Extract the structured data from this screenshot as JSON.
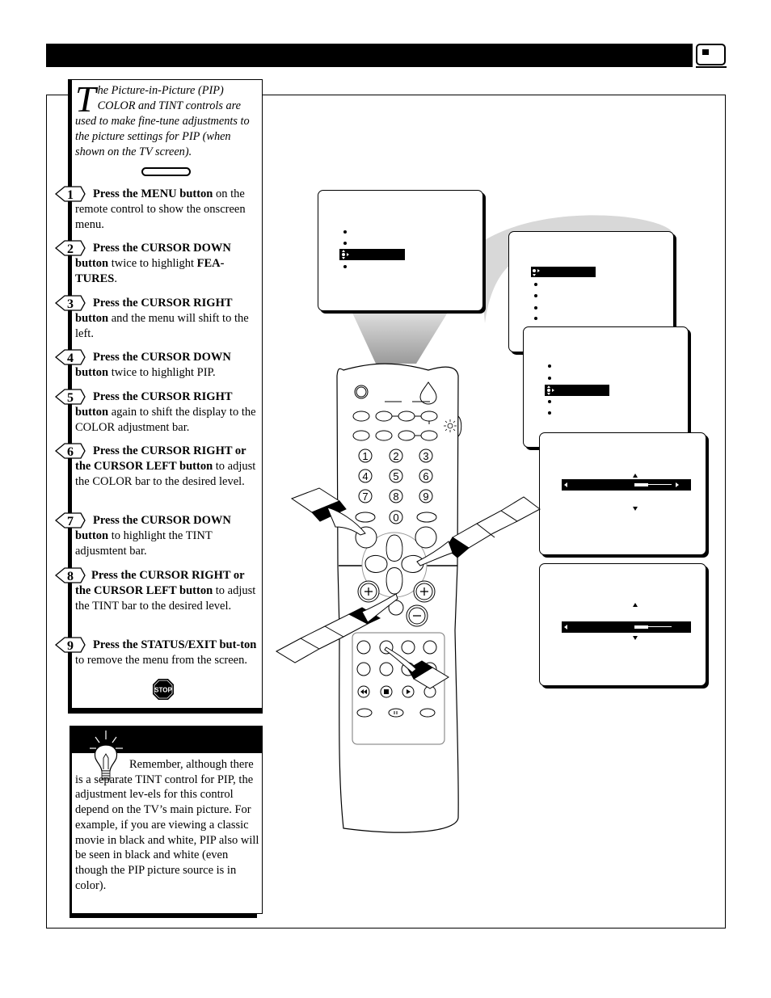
{
  "page": {
    "header_bar_color": "#000000",
    "section_icon": "tv-screen-icon"
  },
  "intro": {
    "dropcap": "T",
    "text": "he Picture-in-Picture (PIP) COLOR and TINT controls are used to make fine-tune adjustments to the picture settings for PIP (when shown on the TV screen)."
  },
  "steps": [
    {
      "number": "1",
      "lead": "Press the MENU button",
      "rest": " on the remote control to show the onscreen menu."
    },
    {
      "number": "2",
      "lead": "Press the CURSOR DOWN button",
      "rest": " twice to highlight ",
      "bold_tail": "FEA-TURES",
      "tail": "."
    },
    {
      "number": "3",
      "lead": "Press the CURSOR RIGHT button",
      "rest": " and the menu will shift to the left."
    },
    {
      "number": "4",
      "lead": "Press the CURSOR DOWN button",
      "rest": " twice to highlight PIP."
    },
    {
      "number": "5",
      "lead": "Press the CURSOR RIGHT button",
      "rest": " again to shift the display to the COLOR adjustment bar."
    },
    {
      "number": "6",
      "lead": "Press the CURSOR RIGHT or the CURSOR LEFT button",
      "rest": " to adjust the COLOR bar to the desired level."
    },
    {
      "number": "7",
      "lead": "Press the CURSOR DOWN button",
      "rest": " to highlight the TINT adjusmtent bar."
    },
    {
      "number": "8",
      "lead": "Press the CURSOR RIGHT or the CURSOR LEFT button",
      "rest": " to adjust the TINT bar to the desired level."
    },
    {
      "number": "9",
      "lead": "Press the STATUS/EXIT but-ton",
      "rest": " to remove the menu from the screen."
    }
  ],
  "stop_sign": "STOP",
  "tip": {
    "icon": "lightbulb-icon",
    "text": "Remember, although there is a separate TINT control for PIP, the adjustment lev-els for this control depend on the TV’s main picture.  For example, if you are viewing a classic movie in black and white, PIP also will be seen in black and white (even though the PIP picture source is in color)."
  },
  "screens": {
    "main_menu": {
      "items": 4,
      "highlighted_index": 2
    },
    "features_menu": {
      "items": 5,
      "highlighted_index": 0
    },
    "pip_menu": {
      "items": 5,
      "highlighted_index": 2
    },
    "color_adjust": {
      "level": 0.55
    },
    "tint_adjust": {
      "level": 0.55
    }
  },
  "remote": {
    "number_keys": [
      "1",
      "2",
      "3",
      "4",
      "5",
      "6",
      "7",
      "8",
      "9",
      "0"
    ]
  }
}
